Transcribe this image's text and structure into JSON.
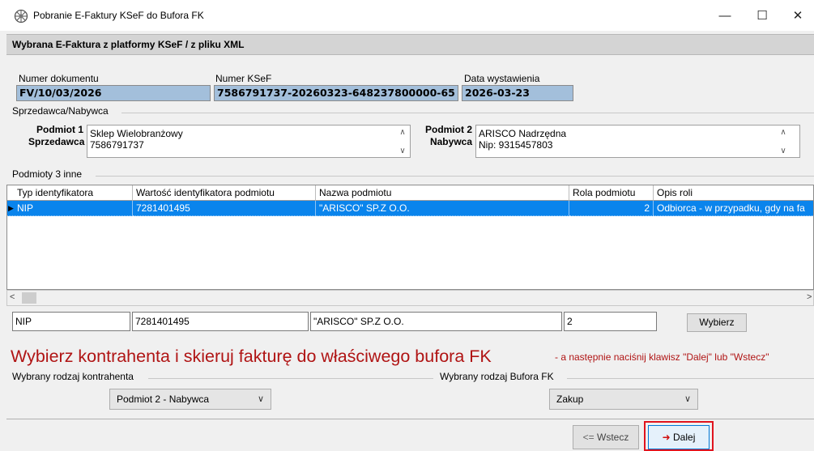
{
  "window": {
    "title": "Pobranie E-Faktury KSeF do Bufora FK",
    "minimize": "—",
    "maximize": "☐",
    "close": "✕"
  },
  "header": {
    "title": "Wybrana E-Faktura z platformy KSeF / z pliku XML"
  },
  "document": {
    "number_label": "Numer dokumentu",
    "number_value": "FV/10/03/2026",
    "ksef_label": "Numer KSeF",
    "ksef_value": "7586791737-20260323-648237800000-65",
    "date_label": "Data wystawienia",
    "date_value": "2026-03-23"
  },
  "parties": {
    "group_label": "Sprzedawca/Nabywca",
    "seller_label_1": "Podmiot 1",
    "seller_label_2": "Sprzedawca",
    "seller_line_1": "Sklep Wielobranżowy",
    "seller_line_2": "7586791737",
    "buyer_label_1": "Podmiot 2",
    "buyer_label_2": "Nabywca",
    "buyer_line_1": "ARISCO Nadrzędna",
    "buyer_line_2": "Nip: 9315457803"
  },
  "others": {
    "group_label": "Podmioty 3 inne",
    "columns": [
      "Typ identyfikatora",
      "Wartość identyfikatora podmiotu",
      "Nazwa podmiotu",
      "Rola podmiotu",
      "Opis roli"
    ],
    "rows": [
      [
        "NIP",
        "7281401495",
        "\"ARISCO\" SP.Z O.O.",
        "2",
        "Odbiorca - w przypadku, gdy na fa"
      ]
    ]
  },
  "selected_row": {
    "type": "NIP",
    "id_value": "7281401495",
    "name": "\"ARISCO\" SP.Z O.O.",
    "role": "2",
    "choose_button": "Wybierz"
  },
  "instruction": {
    "main": "Wybierz kontrahenta i skieruj fakturę do właściwego bufora FK",
    "hint": "- a następnie naciśnij klawisz \"Dalej\" lub \"Wstecz\""
  },
  "contractor_type": {
    "label": "Wybrany rodzaj kontrahenta",
    "value": "Podmiot 2 - Nabywca"
  },
  "buffer_type": {
    "label": "Wybrany rodzaj Bufora FK",
    "value": "Zakup"
  },
  "footer": {
    "back_label": "Wstecz",
    "next_label": "Dalej"
  },
  "colors": {
    "selection": "#0a84ec",
    "field_blue": "#a3bfdb",
    "instruction_red": "#b01414",
    "highlight_border": "#e0141e"
  }
}
